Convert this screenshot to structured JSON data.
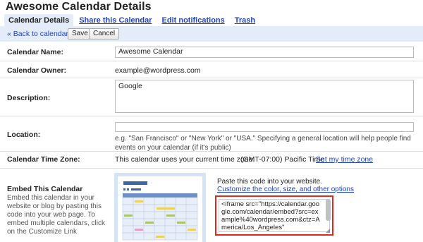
{
  "page": {
    "title": "Awesome Calendar Details"
  },
  "tabs": [
    {
      "label": "Calendar Details"
    },
    {
      "label": "Share this Calendar"
    },
    {
      "label": "Edit notifications"
    },
    {
      "label": "Trash"
    }
  ],
  "toolbar": {
    "back_label": "« Back to calendar",
    "save_label": "Save",
    "cancel_label": "Cancel"
  },
  "fields": {
    "name": {
      "label": "Calendar Name:",
      "value": "Awesome Calendar"
    },
    "owner": {
      "label": "Calendar Owner:",
      "value": "example@wordpress.com"
    },
    "description": {
      "label": "Description:",
      "value": "Google"
    },
    "location": {
      "label": "Location:",
      "value": "",
      "hint": "e.g. \"San Francisco\" or \"New York\" or \"USA.\" Specifying a general location will help people find events on your calendar (if it's public)"
    },
    "timezone": {
      "label": "Calendar Time Zone:",
      "text": "This calendar uses your current time zone:",
      "zone": "(GMT-07:00) Pacific Time",
      "link": "Set my time zone"
    }
  },
  "embed": {
    "label": "Embed This Calendar",
    "description": "Embed this calendar in your website or blog by pasting this code into your web page. To embed multiple calendars, click on the Customize Link",
    "hint": "Paste this code into your website.",
    "customize_link": "Customize the color, size, and other options",
    "code": "<iframe src=\"https://calendar.google.com/calendar/embed?src=example%40wordpress.com&ctz=America/Los_Angeles\""
  },
  "colors": {
    "accent": "#e5ecf9",
    "link": "#2244bb",
    "highlight": "#e0281e"
  }
}
